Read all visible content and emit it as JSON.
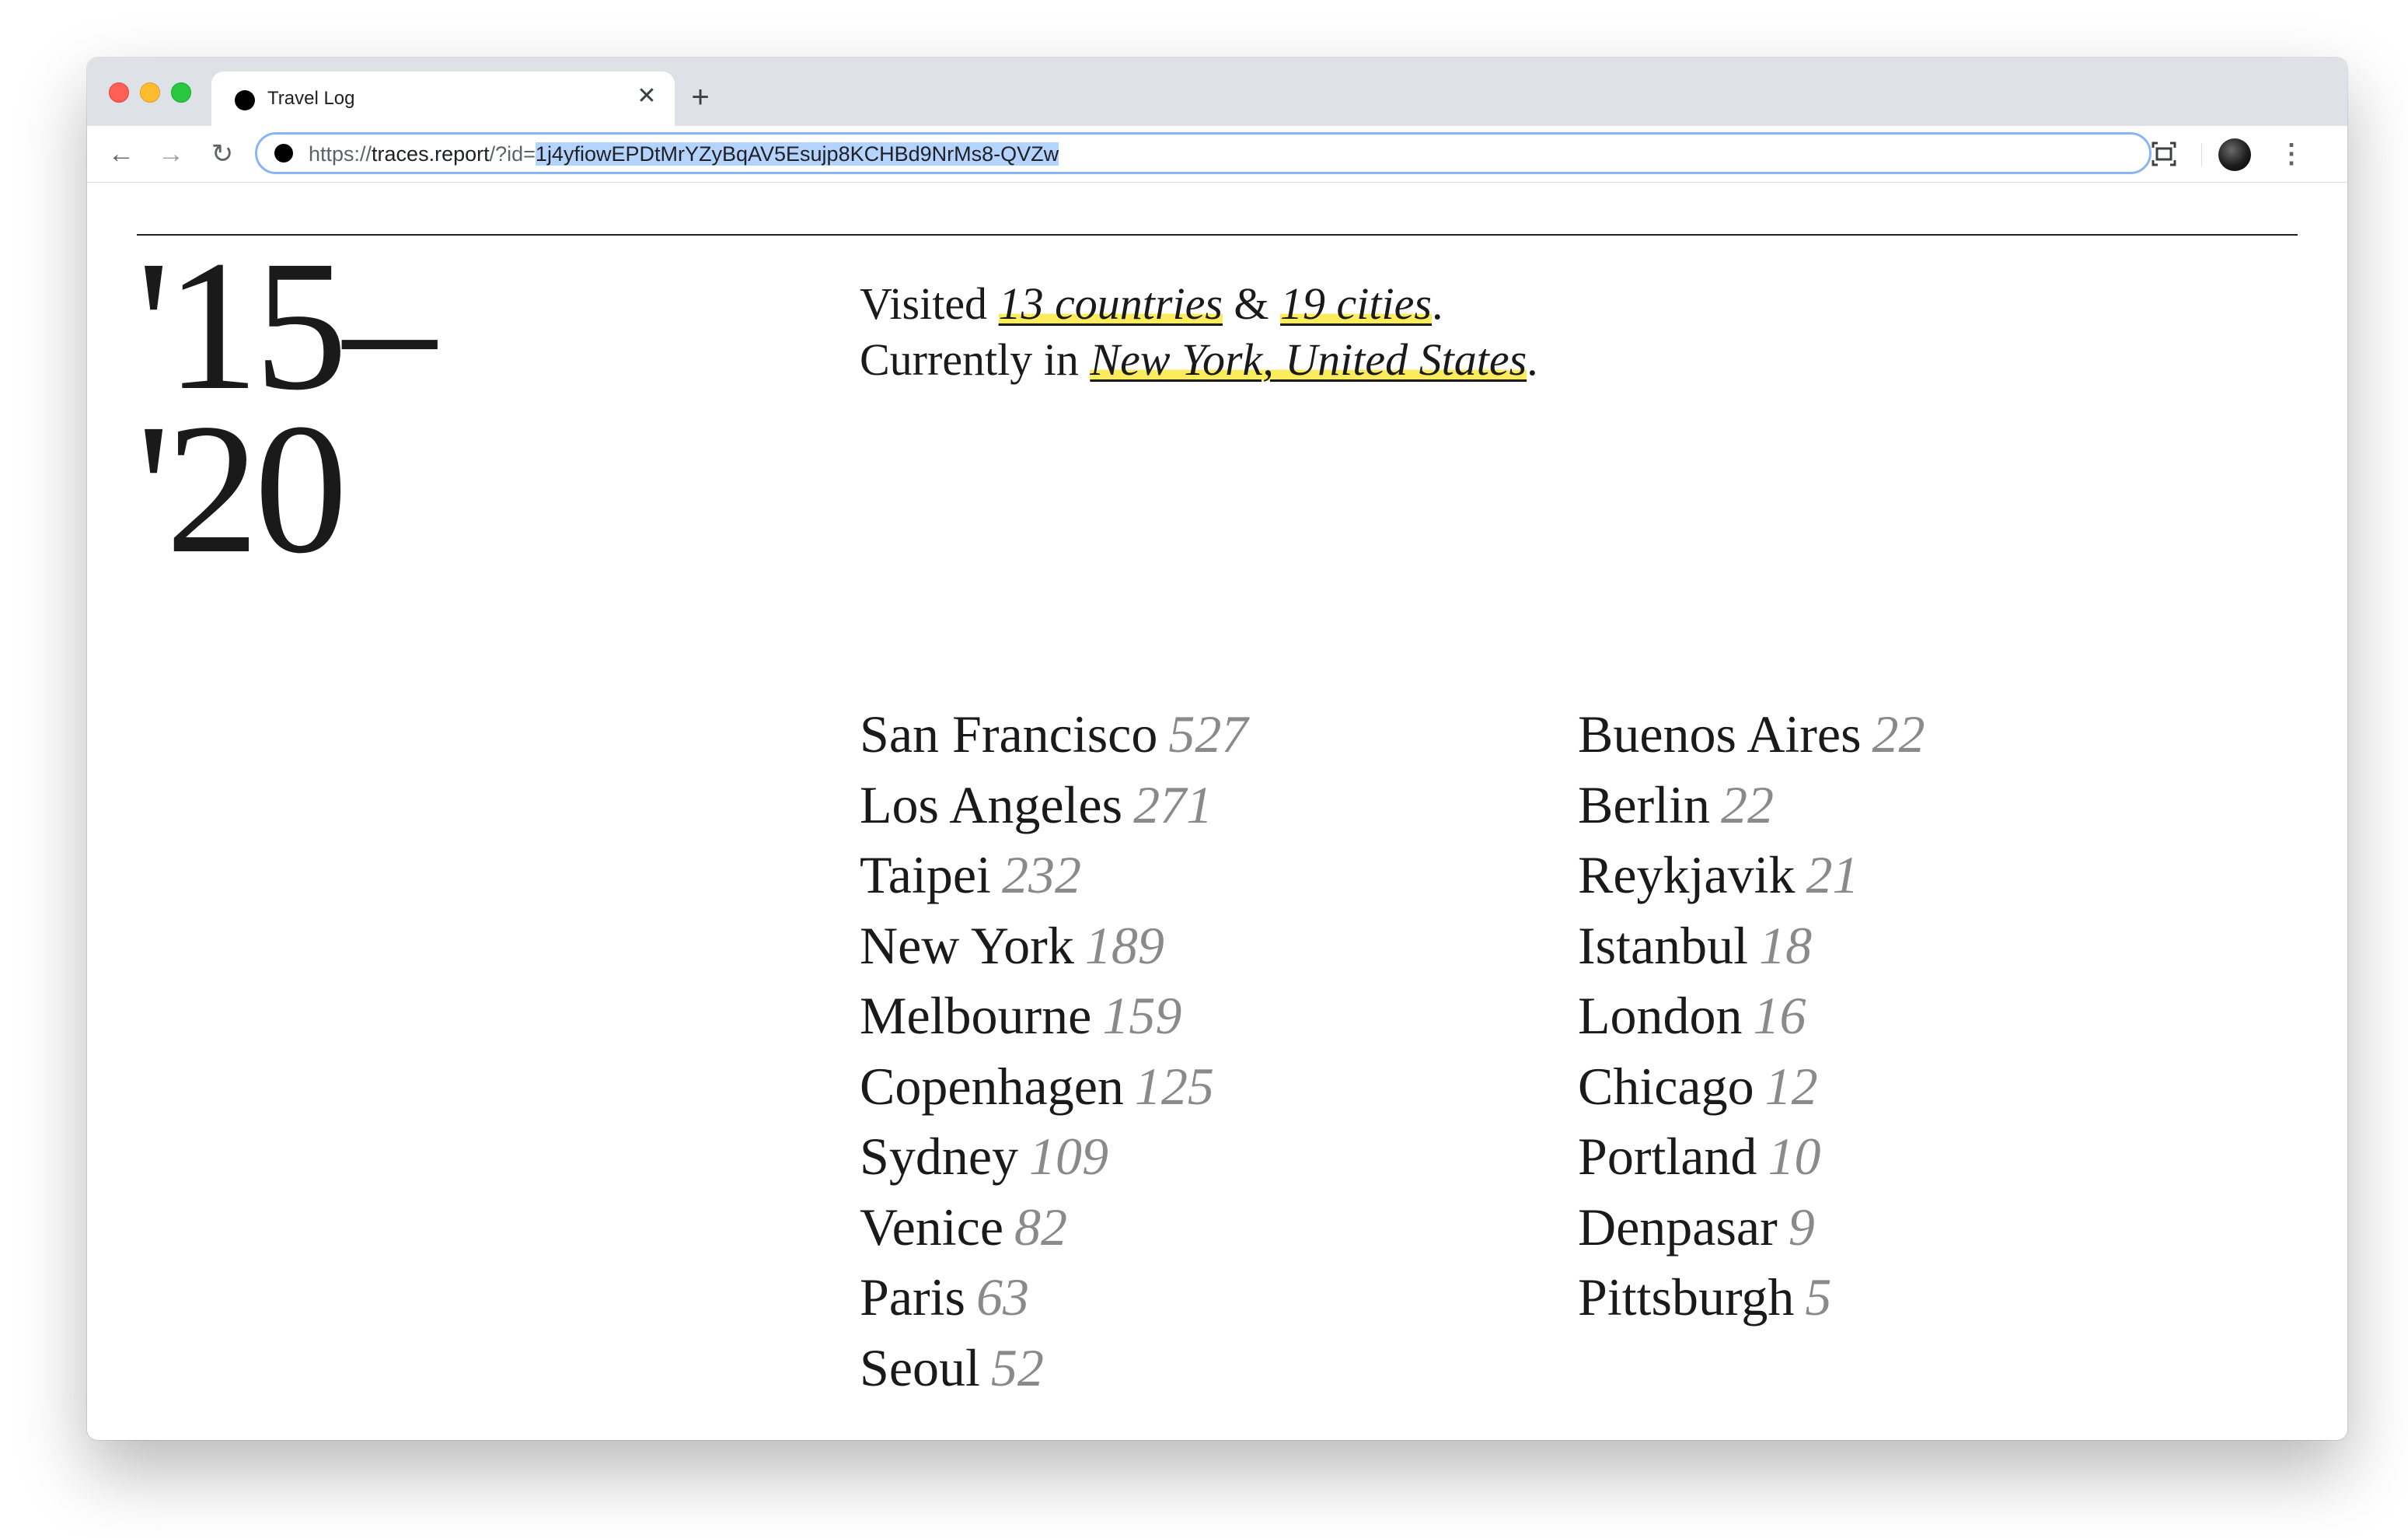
{
  "browser": {
    "tab": {
      "title": "Travel Log",
      "close_glyph": "✕"
    },
    "new_tab_glyph": "+",
    "nav": {
      "back_glyph": "←",
      "forward_glyph": "→",
      "reload_glyph": "↻"
    },
    "url": {
      "scheme": "https://",
      "host": "traces.report",
      "path": "/?id=",
      "selected": "1j4yfiowEPDtMrYZyBqAV5Esujp8KCHBd9NrMs8-QVZw"
    },
    "menu_glyph": "⋮",
    "screenshot_glyph": "⛶"
  },
  "page": {
    "years": {
      "line1": "'15–",
      "line2": "'20"
    },
    "summary": {
      "visited_prefix": "Visited ",
      "countries": "13 countries",
      "amp": " & ",
      "cities": "19 cities",
      "period1": ".",
      "currently_prefix": "Currently in ",
      "current_location": "New York, United States",
      "period2": "."
    },
    "cities_left": [
      {
        "name": "San Francisco",
        "count": "527"
      },
      {
        "name": "Los Angeles",
        "count": "271"
      },
      {
        "name": "Taipei",
        "count": "232"
      },
      {
        "name": "New York",
        "count": "189"
      },
      {
        "name": "Melbourne",
        "count": "159"
      },
      {
        "name": "Copenhagen",
        "count": "125"
      },
      {
        "name": "Sydney",
        "count": "109"
      },
      {
        "name": "Venice",
        "count": "82"
      },
      {
        "name": "Paris",
        "count": "63"
      },
      {
        "name": "Seoul",
        "count": "52"
      }
    ],
    "cities_right": [
      {
        "name": "Buenos Aires",
        "count": "22"
      },
      {
        "name": "Berlin",
        "count": "22"
      },
      {
        "name": "Reykjavik",
        "count": "21"
      },
      {
        "name": "Istanbul",
        "count": "18"
      },
      {
        "name": "London",
        "count": "16"
      },
      {
        "name": "Chicago",
        "count": "12"
      },
      {
        "name": "Portland",
        "count": "10"
      },
      {
        "name": "Denpasar",
        "count": "9"
      },
      {
        "name": "Pittsburgh",
        "count": "5"
      }
    ]
  },
  "colors": {
    "highlight": "#fbec5d",
    "count_gray": "#8a8a8a",
    "text": "#1a1a1a",
    "selection": "#b4d4ff"
  }
}
